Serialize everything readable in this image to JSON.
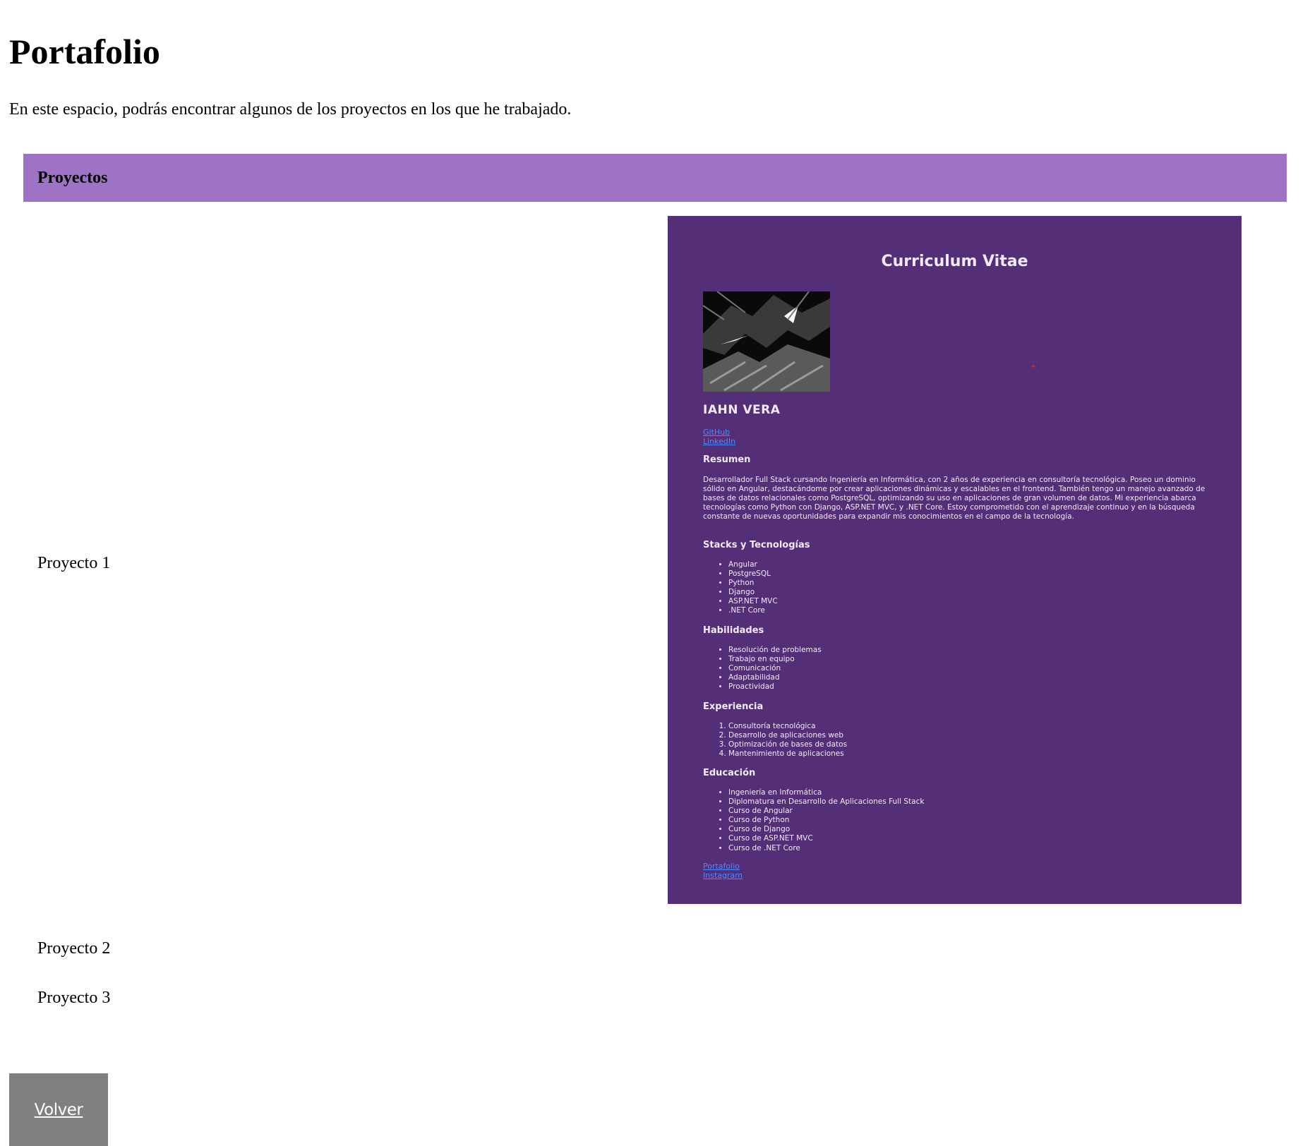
{
  "page": {
    "title": "Portafolio",
    "intro": "En este espacio, podrás encontrar algunos de los proyectos en los que he trabajado."
  },
  "section": {
    "header": "Proyectos"
  },
  "projects": [
    {
      "label": "Proyecto 1"
    },
    {
      "label": "Proyecto 2"
    },
    {
      "label": "Proyecto 3"
    }
  ],
  "cv": {
    "title": "Curriculum Vitae",
    "name": "IAHN VERA",
    "links_top": [
      "GitHub",
      "LinkedIn"
    ],
    "resumen_heading": "Resumen",
    "resumen": "Desarrollador Full Stack cursando Ingeniería en Informática, con 2 años de experiencia en consultoría tecnológica. Poseo un dominio sólido en Angular, destacándome por crear aplicaciones dinámicas y escalables en el frontend. También tengo un manejo avanzado de bases de datos relacionales como PostgreSQL, optimizando su uso en aplicaciones de gran volumen de datos. Mi experiencia abarca tecnologías como Python con Django, ASP.NET MVC, y .NET Core. Estoy comprometido con el aprendizaje continuo y en la búsqueda constante de nuevas oportunidades para expandir mis conocimientos en el campo de la tecnología.",
    "stacks_heading": "Stacks y Tecnologías",
    "stacks": [
      "Angular",
      "PostgreSQL",
      "Python",
      "Django",
      "ASP.NET MVC",
      ".NET Core"
    ],
    "habilidades_heading": "Habilidades",
    "habilidades": [
      "Resolución de problemas",
      "Trabajo en equipo",
      "Comunicación",
      "Adaptabilidad",
      "Proactividad"
    ],
    "experiencia_heading": "Experiencia",
    "experiencia": [
      "Consultoría tecnológica",
      "Desarrollo de aplicaciones web",
      "Optimización de bases de datos",
      "Mantenimiento de aplicaciones"
    ],
    "educacion_heading": "Educación",
    "educacion": [
      "Ingeniería en Informática",
      "Diplomatura en Desarrollo de Aplicaciones Full Stack",
      "Curso de Angular",
      "Curso de Python",
      "Curso de Django",
      "Curso de ASP.NET MVC",
      "Curso de .NET Core"
    ],
    "links_bottom": [
      "Portafolio",
      "Instagram"
    ],
    "colors": {
      "background": "#542e77",
      "link": "#4a8cff"
    }
  },
  "colors": {
    "section_header": "#9e73c6",
    "back_button": "#808080"
  },
  "back_button": {
    "label": "Volver"
  }
}
